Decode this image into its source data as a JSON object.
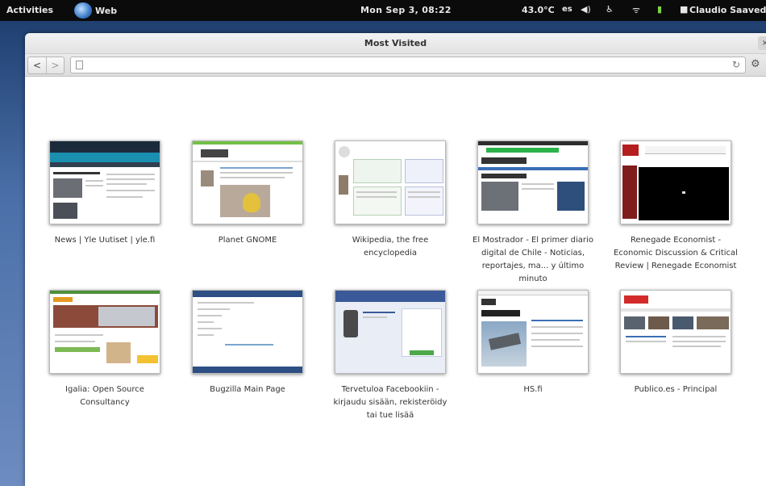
{
  "topbar": {
    "activities": "Activities",
    "app_name": "Web",
    "clock": "Mon Sep 3, 08:22",
    "temperature": "43.0°C",
    "keyboard": "es",
    "volume_icon": "volume-icon",
    "accessibility_icon": "accessibility-icon",
    "network_icon": "wifi-icon",
    "battery_icon": "battery-icon",
    "chat_icon": "chat-icon",
    "user": "Claudio Saavedra"
  },
  "window": {
    "title": "Most Visited",
    "close_label": "×",
    "back_label": "<",
    "forward_label": ">",
    "url_value": "",
    "reload_label": "↻",
    "gear_label": "⚙"
  },
  "tiles": [
    {
      "label": "News | Yle Uutiset | yle.fi"
    },
    {
      "label": "Planet GNOME"
    },
    {
      "label": "Wikipedia, the free encyclopedia"
    },
    {
      "label": "El Mostrador - El primer diario digital de Chile - Noticias, reportajes, ma... y último minuto"
    },
    {
      "label": "Renegade Economist - Economic Discussion & Critical Review | Renegade Economist"
    },
    {
      "label": "Igalia: Open Source Consultancy"
    },
    {
      "label": "Bugzilla Main Page"
    },
    {
      "label": "Tervetuloa Facebookiin - kirjaudu sisään, rekisteröidy tai tue lisää"
    },
    {
      "label": "HS.fi"
    },
    {
      "label": "Publico.es - Principal"
    }
  ]
}
